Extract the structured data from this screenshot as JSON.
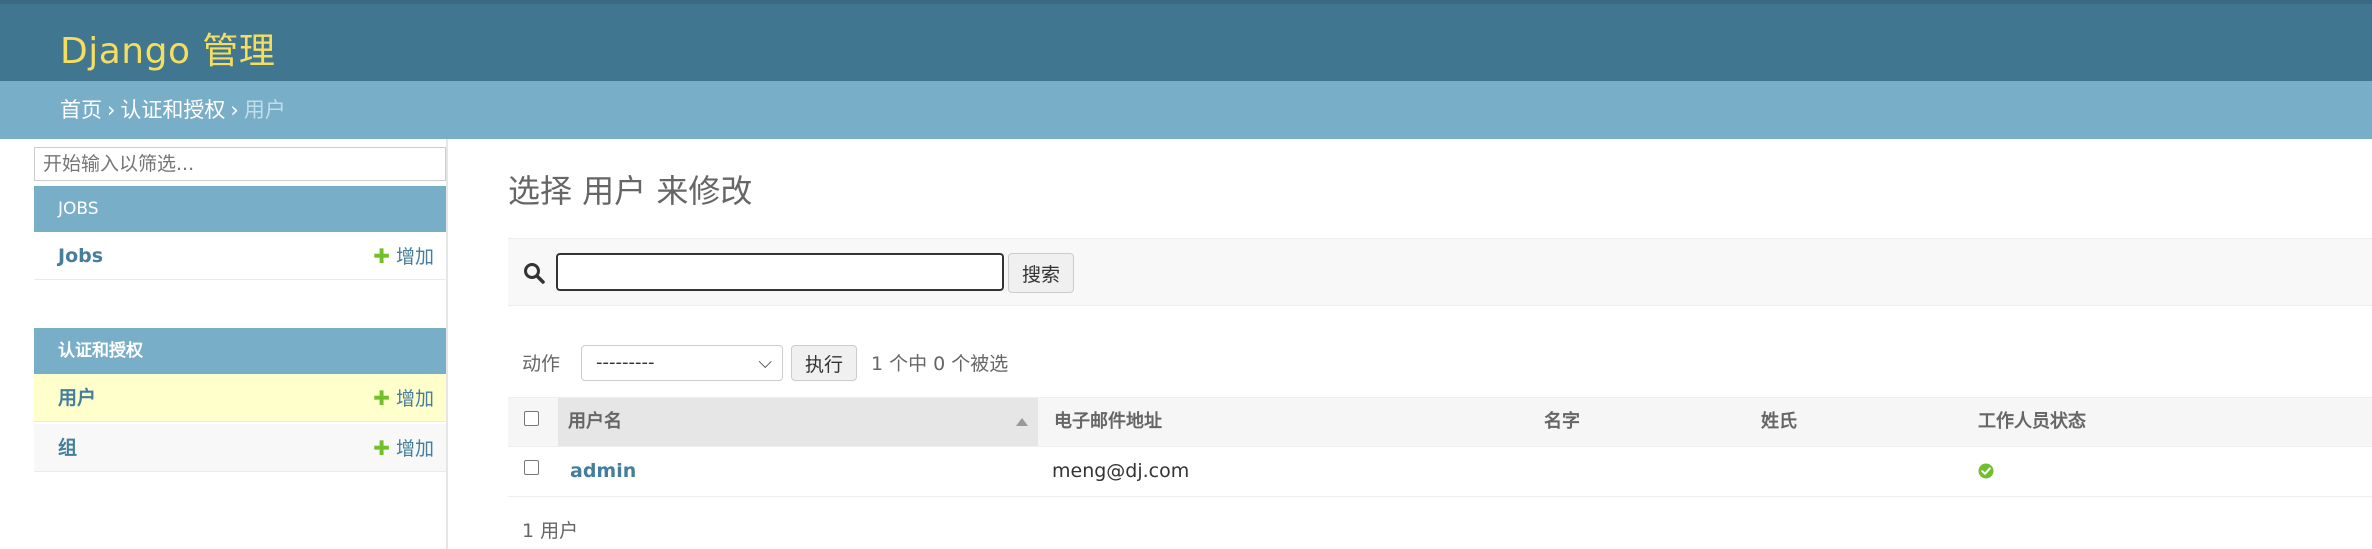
{
  "header": {
    "brand": "Django 管理"
  },
  "breadcrumbs": {
    "home": "首页",
    "app": "认证和授权",
    "current": "用户",
    "separator": "›"
  },
  "sidebar": {
    "filter_placeholder": "开始输入以筛选...",
    "modules": [
      {
        "caption": "JOBS",
        "items": [
          {
            "label": "Jobs",
            "add_label": "增加"
          }
        ]
      },
      {
        "caption": "认证和授权",
        "items": [
          {
            "label": "用户",
            "add_label": "增加",
            "current": true
          },
          {
            "label": "组",
            "add_label": "增加"
          }
        ]
      }
    ]
  },
  "main": {
    "title": "选择 用户 来修改",
    "search": {
      "value": "",
      "button_label": "搜索"
    },
    "actions": {
      "label": "动作",
      "selected": "---------",
      "go_label": "执行",
      "counter": "1 个中 0 个被选"
    },
    "table": {
      "columns": [
        "用户名",
        "电子邮件地址",
        "名字",
        "姓氏",
        "工作人员状态"
      ],
      "rows": [
        {
          "username": "admin",
          "email": "meng@dj.com",
          "first_name": "",
          "last_name": "",
          "is_staff": true
        }
      ]
    },
    "paginator": "1 用户"
  },
  "colors": {
    "header_bg": "#417690",
    "brand": "#f5dd5d",
    "breadcrumb_bg": "#79aec8",
    "link": "#447e9b",
    "add": "#70bf2b",
    "current_row": "#ffffcc"
  },
  "icons": {
    "search": "search-icon",
    "add": "plus-icon",
    "sort": "sort-ascending-icon",
    "status": "check-circle-icon",
    "dropdown": "chevron-down-icon"
  }
}
